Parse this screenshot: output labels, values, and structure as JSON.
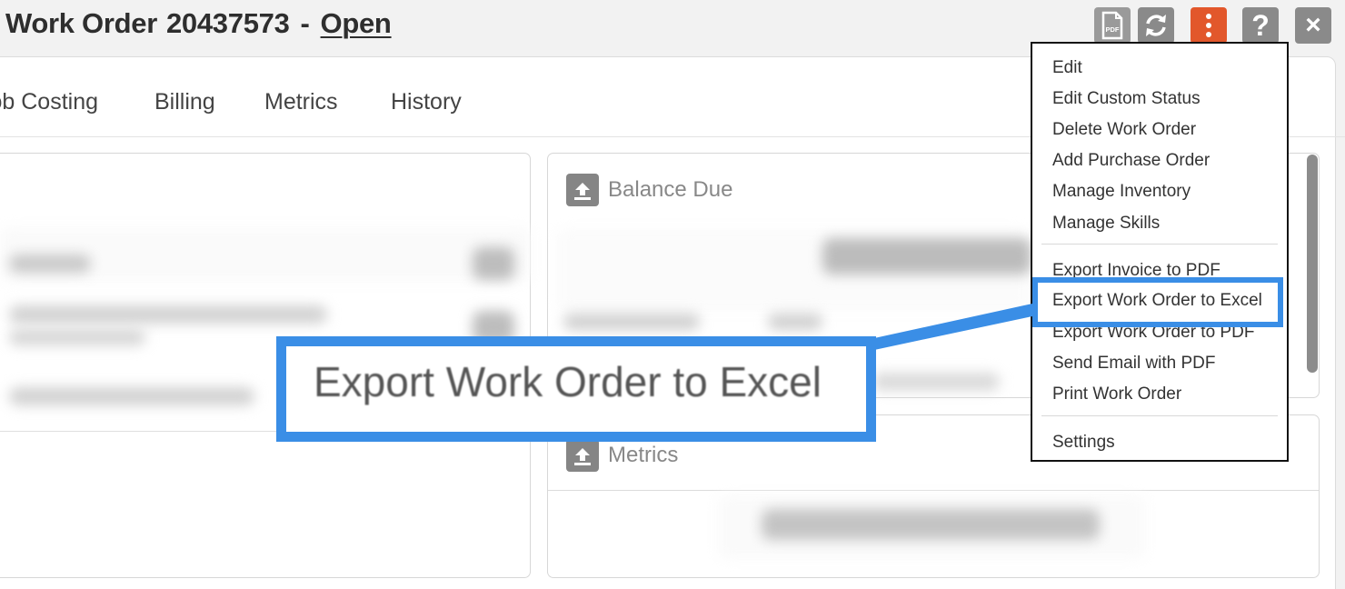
{
  "header": {
    "title": "Work Order",
    "number": "20437573",
    "separator": "-",
    "status": "Open"
  },
  "toolbar": {
    "pdf_label": "PDF",
    "help_label": "?",
    "close_label": "×"
  },
  "tabs": [
    {
      "label": "Job Costing"
    },
    {
      "label": "Billing"
    },
    {
      "label": "Metrics"
    },
    {
      "label": "History"
    }
  ],
  "cards": {
    "balance_due": "Balance Due",
    "metrics": "Metrics"
  },
  "menu": {
    "items": [
      "Edit",
      "Edit Custom Status",
      "Delete Work Order",
      "Add Purchase Order",
      "Manage Inventory",
      "Manage Skills",
      "Export Invoice to PDF",
      "Export Work Order to Excel",
      "Export Work Order to PDF",
      "Send Email with PDF",
      "Print Work Order",
      "Settings"
    ]
  },
  "callout": {
    "text": "Export Work Order to Excel"
  },
  "colors": {
    "accent_orange": "#e2572b",
    "highlight_blue": "#3a8ee6",
    "icon_gray": "#8a8a8a"
  }
}
